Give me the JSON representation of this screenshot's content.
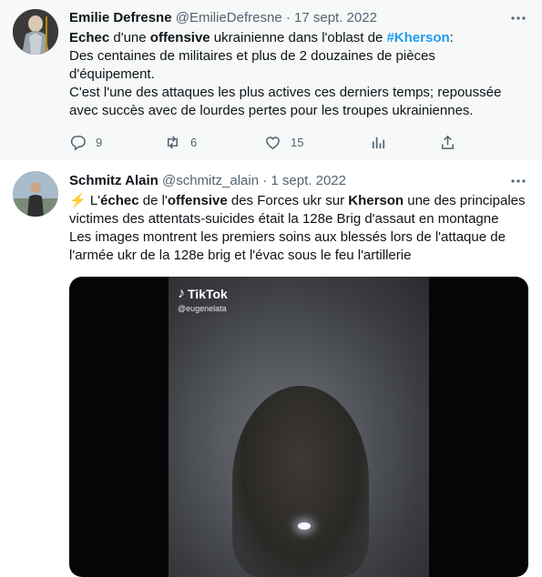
{
  "tweets": [
    {
      "name": "Emilie Defresne",
      "handle": "@EmilieDefresne",
      "sep": " · ",
      "date": "17 sept. 2022",
      "body": {
        "l1_b1": "Echec",
        "l1_t1": " d'une ",
        "l1_b2": "offensive",
        "l1_t2": " ukrainienne dans l'oblast de ",
        "l1_hashtag": "#Kherson",
        "l1_t3": ":",
        "l2": "Des centaines de militaires et plus de 2 douzaines de pièces",
        "l3": "d'équipement.",
        "l4": "C'est l'une des attaques les plus actives ces derniers temps; repoussée",
        "l5": "avec succès avec de lourdes pertes pour les troupes ukrainiennes."
      },
      "actions": {
        "replies": "9",
        "retweets": "6",
        "likes": "15"
      }
    },
    {
      "name": "Schmitz Alain",
      "handle": "@schmitz_alain",
      "sep": " · ",
      "date": "1 sept. 2022",
      "body": {
        "emoji": "⚡",
        "l1_t1": " L'",
        "l1_b1": "échec",
        "l1_t2": " de l'",
        "l1_b2": "offensive",
        "l1_t3": " des Forces ukr sur ",
        "l1_b3": "Kherson",
        "l1_t4": " une des principales",
        "l2": "victimes des attentats-suicides était la 128e Brig d'assaut en montagne",
        "l3": "Les images montrent les premiers soins aux blessés lors de l'attaque de",
        "l4": "l'armée ukr de la 128e brig et l'évac sous le feu l'artillerie"
      },
      "media": {
        "brand": "TikTok",
        "brand_handle": "@eugenelata"
      }
    }
  ],
  "icons": {
    "more": "more-horizontal-icon",
    "reply": "reply-icon",
    "retweet": "retweet-icon",
    "like": "heart-icon",
    "views": "views-icon",
    "share": "share-icon"
  }
}
